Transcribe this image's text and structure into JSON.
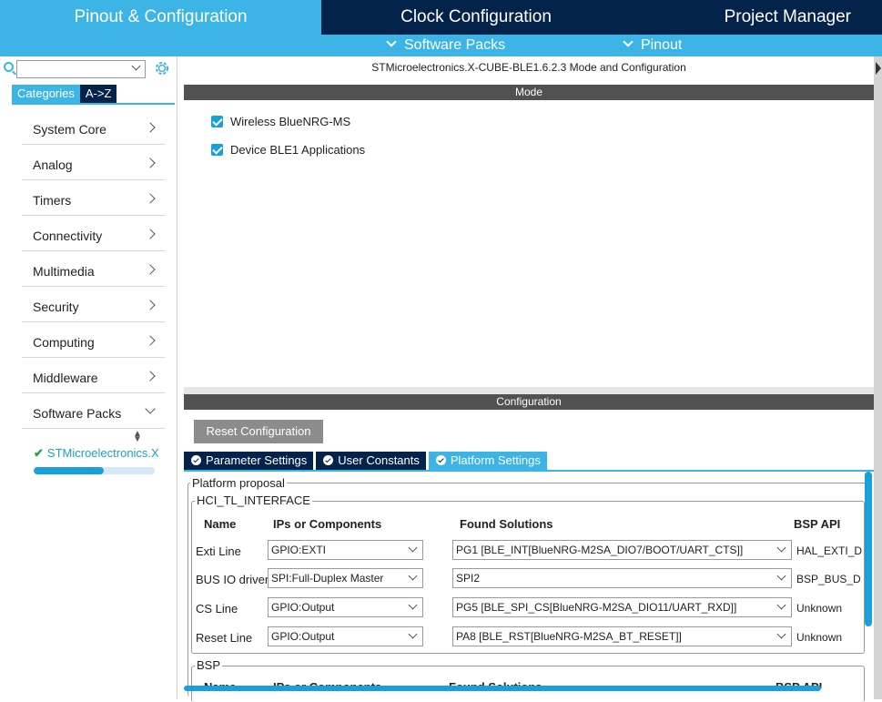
{
  "top_tabs": [
    "Pinout & Configuration",
    "Clock Configuration",
    "Project Manager"
  ],
  "sub_menu": [
    "Software Packs",
    "Pinout"
  ],
  "sidebar": {
    "category_tabs": [
      "Categories",
      "A->Z"
    ],
    "categories": [
      "System Core",
      "Analog",
      "Timers",
      "Connectivity",
      "Multimedia",
      "Security",
      "Computing",
      "Middleware",
      "Software Packs"
    ],
    "package_item": "STMicroelectronics.X",
    "package_progress": 0.58
  },
  "main": {
    "title": "STMicroelectronics.X-CUBE-BLE1.6.2.3 Mode and Configuration",
    "mode_header": "Mode",
    "mode_items": [
      "Wireless BlueNRG-MS",
      "Device BLE1 Applications"
    ],
    "config_header": "Configuration",
    "reset_button": "Reset Configuration",
    "config_tabs": [
      "Parameter Settings",
      "User Constants",
      "Platform Settings"
    ],
    "platform_proposal_legend": "Platform proposal",
    "hci_legend": "HCI_TL_INTERFACE",
    "bsp_legend": "BSP",
    "columns": [
      "Name",
      "IPs or Components",
      "Found Solutions",
      "BSP API"
    ],
    "rows": [
      {
        "name": "Exti Line",
        "ip": "GPIO:EXTI",
        "solution": "PG1 [BLE_INT[BlueNRG-M2SA_DIO7/BOOT/UART_CTS]]",
        "api": "HAL_EXTI_D"
      },
      {
        "name": "BUS IO driver",
        "ip": "SPI:Full-Duplex Master",
        "solution": "SPI2",
        "api": "BSP_BUS_D"
      },
      {
        "name": "CS Line",
        "ip": "GPIO:Output",
        "solution": "PG5 [BLE_SPI_CS[BlueNRG-M2SA_DIO11/UART_RXD]]",
        "api": "Unknown"
      },
      {
        "name": "Reset Line",
        "ip": "GPIO:Output",
        "solution": "PA8 [BLE_RST[BlueNRG-M2SA_BT_RESET]]",
        "api": "Unknown"
      }
    ],
    "bsp_columns_partial": [
      "Name",
      "IPs or Components",
      "Found Solutions",
      "BSP API"
    ]
  },
  "colors": {
    "navy": "#03234b",
    "accent": "#3cb4e6",
    "check_green": "#25a349"
  }
}
